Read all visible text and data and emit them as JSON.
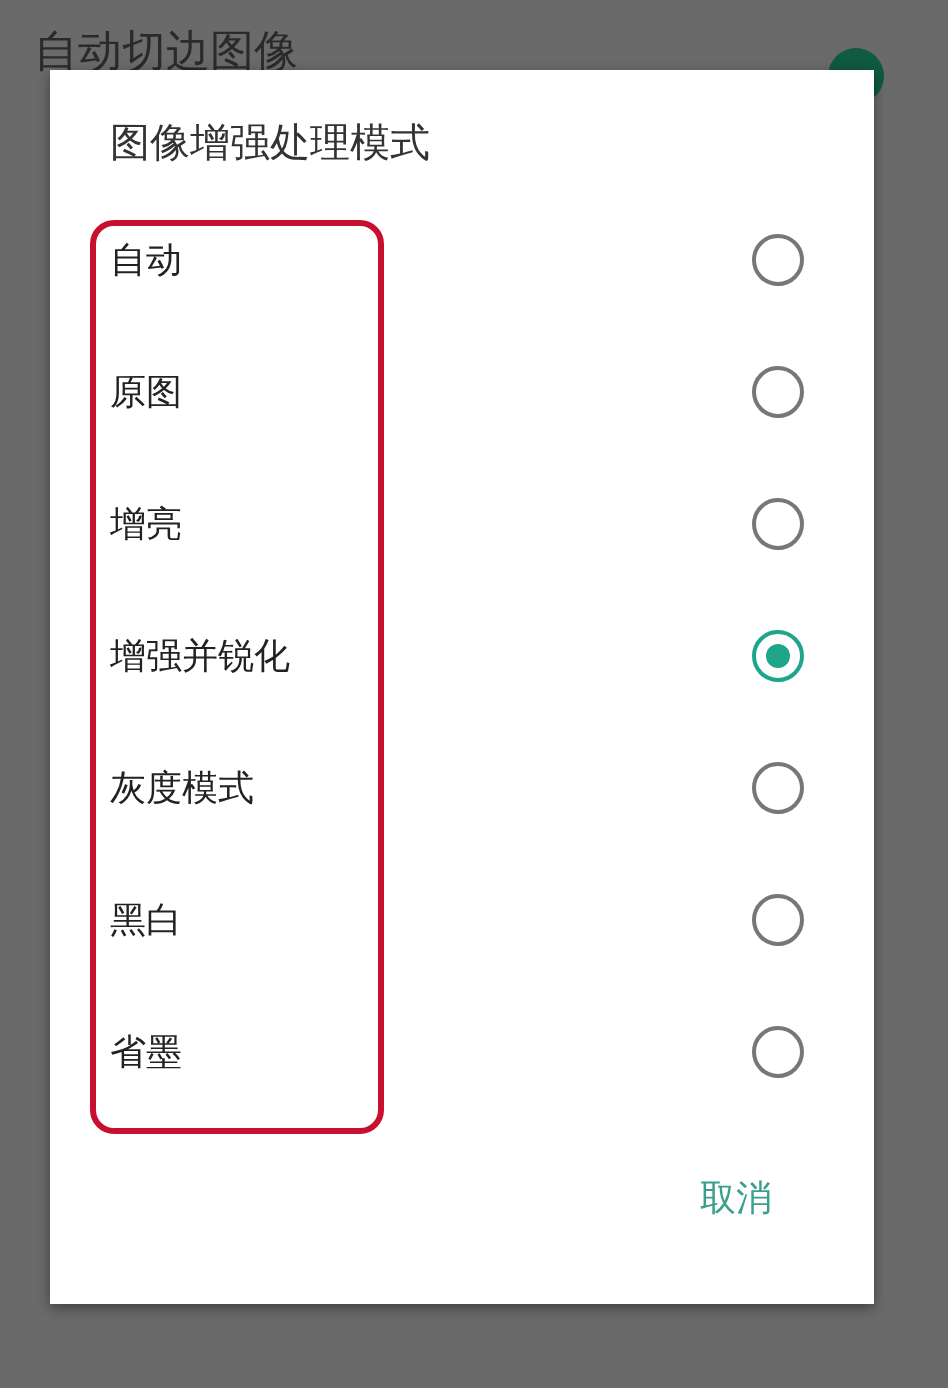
{
  "background": {
    "setting_title": "自动切边图像",
    "switch_on": true
  },
  "dialog": {
    "title": "图像增强处理模式",
    "options": [
      {
        "label": "自动",
        "selected": false
      },
      {
        "label": "原图",
        "selected": false
      },
      {
        "label": "增亮",
        "selected": false
      },
      {
        "label": "增强并锐化",
        "selected": true
      },
      {
        "label": "灰度模式",
        "selected": false
      },
      {
        "label": "黑白",
        "selected": false
      },
      {
        "label": "省墨",
        "selected": false
      }
    ],
    "buttons": [
      "取消"
    ]
  }
}
